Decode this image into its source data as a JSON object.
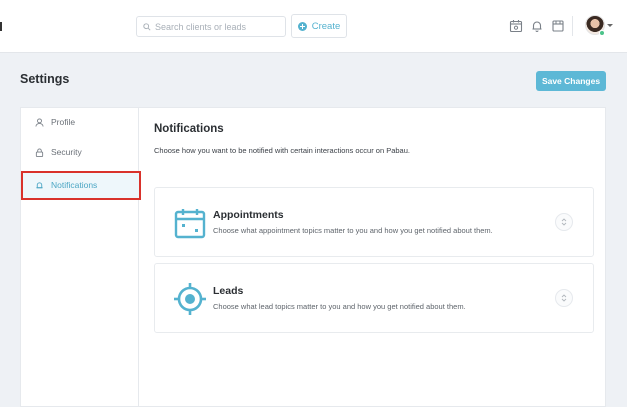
{
  "header": {
    "search_placeholder": "Search clients or leads",
    "create_label": "Create"
  },
  "page": {
    "title": "Settings",
    "save_label": "Save Changes"
  },
  "sidebar": {
    "items": [
      {
        "label": "Profile",
        "icon": "user-icon",
        "active": false
      },
      {
        "label": "Security",
        "icon": "lock-icon",
        "active": false
      },
      {
        "label": "Notifications",
        "icon": "bell-icon",
        "active": true
      }
    ]
  },
  "content": {
    "title": "Notifications",
    "description": "Choose how you want to be notified with certain interactions occur on Pabau.",
    "topics": [
      {
        "title": "Appointments",
        "description": "Choose what appointment topics matter to you and how you get notified about them.",
        "icon": "calendar-icon"
      },
      {
        "title": "Leads",
        "description": "Choose what lead topics matter to you and how you get notified about them.",
        "icon": "target-icon"
      }
    ]
  },
  "colors": {
    "accent": "#5db8d6",
    "highlight": "#d9322b"
  }
}
